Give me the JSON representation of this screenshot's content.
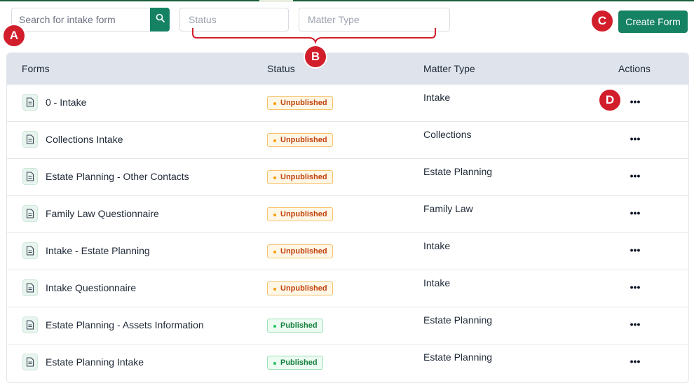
{
  "search": {
    "placeholder": "Search for intake form",
    "icon": "search-icon"
  },
  "filters": {
    "status_placeholder": "Status",
    "matter_type_placeholder": "Matter Type"
  },
  "actions": {
    "create_form_label": "Create Form"
  },
  "callouts": {
    "a": "A",
    "b": "B",
    "c": "C",
    "d": "D"
  },
  "table": {
    "headers": {
      "forms": "Forms",
      "status": "Status",
      "matter_type": "Matter Type",
      "actions": "Actions"
    },
    "rows": [
      {
        "name": "0 - Intake",
        "status": "Unpublished",
        "matter_type": "Intake",
        "action": "•••"
      },
      {
        "name": "Collections Intake",
        "status": "Unpublished",
        "matter_type": "Collections",
        "action": "•••"
      },
      {
        "name": "Estate Planning - Other Contacts",
        "status": "Unpublished",
        "matter_type": "Estate Planning",
        "action": "•••"
      },
      {
        "name": "Family Law Questionnaire",
        "status": "Unpublished",
        "matter_type": "Family Law",
        "action": "•••"
      },
      {
        "name": "Intake - Estate Planning",
        "status": "Unpublished",
        "matter_type": "Intake",
        "action": "•••"
      },
      {
        "name": "Intake Questionnaire",
        "status": "Unpublished",
        "matter_type": "Intake",
        "action": "•••"
      },
      {
        "name": "Estate Planning - Assets Information",
        "status": "Published",
        "matter_type": "Estate Planning",
        "action": "•••"
      },
      {
        "name": "Estate Planning Intake",
        "status": "Published",
        "matter_type": "Estate Planning",
        "action": "•••"
      }
    ]
  },
  "colors": {
    "primary": "#168264",
    "callout": "#d21e2b",
    "header_bg": "#dfe4ec",
    "unpublished": "#c2410c",
    "published": "#15803d"
  }
}
